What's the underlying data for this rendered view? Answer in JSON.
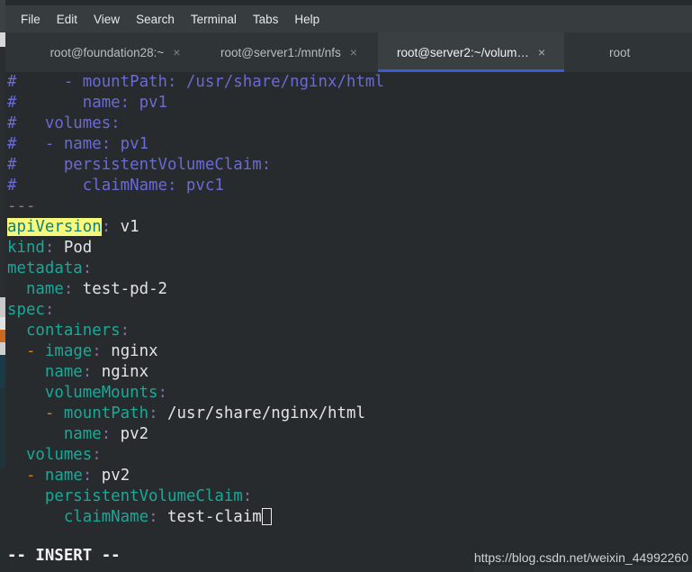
{
  "window": {
    "app": "Terminal",
    "background_color": "#272b2e"
  },
  "menubar": {
    "items": [
      {
        "label": "File"
      },
      {
        "label": "Edit"
      },
      {
        "label": "View"
      },
      {
        "label": "Search"
      },
      {
        "label": "Terminal"
      },
      {
        "label": "Tabs"
      },
      {
        "label": "Help"
      }
    ]
  },
  "tabbar": {
    "close_glyph": "×",
    "active_underline_color": "#3b5bd4",
    "tabs": [
      {
        "title": "root@foundation28:~",
        "active": false
      },
      {
        "title": "root@server1:/mnt/nfs",
        "active": false
      },
      {
        "title": "root@server2:~/volum…",
        "active": true
      },
      {
        "title": "root",
        "active": false
      }
    ]
  },
  "editor": {
    "lines": [
      {
        "type": "comment",
        "text": "#     - mountPath: /usr/share/nginx/html"
      },
      {
        "type": "comment",
        "text": "#       name: pv1"
      },
      {
        "type": "comment",
        "text": "#   volumes:"
      },
      {
        "type": "comment",
        "text": "#   - name: pv1"
      },
      {
        "type": "comment",
        "text": "#     persistentVolumeClaim:"
      },
      {
        "type": "comment",
        "text": "#       claimName: pvc1"
      },
      {
        "type": "doc",
        "text": "---"
      },
      {
        "type": "kv",
        "indent": "",
        "highlight_key": true,
        "key": "apiVersion",
        "value": " v1"
      },
      {
        "type": "kv",
        "indent": "",
        "key": "kind",
        "value": " Pod"
      },
      {
        "type": "kv",
        "indent": "",
        "key": "metadata",
        "value": ""
      },
      {
        "type": "kv",
        "indent": "  ",
        "key": "name",
        "value": " test-pd-2"
      },
      {
        "type": "kv",
        "indent": "",
        "key": "spec",
        "value": ""
      },
      {
        "type": "kv",
        "indent": "  ",
        "key": "containers",
        "value": ""
      },
      {
        "type": "item",
        "indent": "  ",
        "key": "image",
        "value": " nginx"
      },
      {
        "type": "kv",
        "indent": "    ",
        "key": "name",
        "value": " nginx"
      },
      {
        "type": "kv",
        "indent": "    ",
        "key": "volumeMounts",
        "value": ""
      },
      {
        "type": "item",
        "indent": "    ",
        "key": "mountPath",
        "value": " /usr/share/nginx/html"
      },
      {
        "type": "kv",
        "indent": "      ",
        "key": "name",
        "value": " pv2"
      },
      {
        "type": "kv",
        "indent": "  ",
        "key": "volumes",
        "value": ""
      },
      {
        "type": "item",
        "indent": "  ",
        "key": "name",
        "value": " pv2"
      },
      {
        "type": "kv",
        "indent": "    ",
        "key": "persistentVolumeClaim",
        "value": ""
      },
      {
        "type": "kv-cursor",
        "indent": "      ",
        "key": "claimName",
        "value": " test-claim"
      }
    ],
    "colors": {
      "comment": "#6a6ad4",
      "doc_marker": "#b05fb0",
      "key": "#18a999",
      "colon": "#8a6fa8",
      "value": "#e4e4e4",
      "list_dash": "#d08020",
      "search_highlight_bg": "#f6f97a",
      "search_highlight_fg": "#157f77"
    }
  },
  "statusline": {
    "mode": "-- INSERT --"
  },
  "watermark": {
    "url": "https://blog.csdn.net/weixin_44992260"
  }
}
